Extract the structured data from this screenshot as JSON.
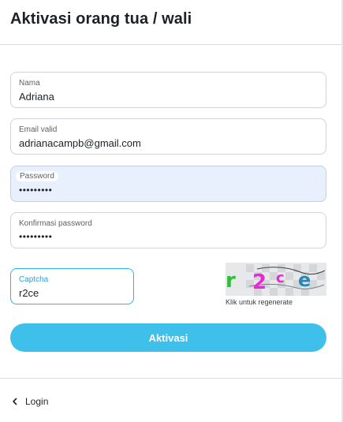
{
  "header": {
    "title": "Aktivasi orang tua / wali"
  },
  "form": {
    "name": {
      "label": "Nama",
      "value": "Adriana"
    },
    "email": {
      "label": "Email valid",
      "value": "adrianacampb@gmail.com"
    },
    "password": {
      "label": "Password",
      "value": "•••••••••"
    },
    "confirm": {
      "label": "Konfirmasi password",
      "value": "•••••••••"
    },
    "captcha": {
      "label": "Captcha",
      "value": "r2ce"
    },
    "captcha_image": {
      "text": "r2ce",
      "hint": "Klik untuk regenerate"
    },
    "submit_label": "Aktivasi"
  },
  "footer": {
    "login_label": "Login"
  },
  "colors": {
    "accent": "#3ec0ea",
    "focus_border": "#2bb3e6",
    "autofill_bg": "#e8f0fe"
  }
}
